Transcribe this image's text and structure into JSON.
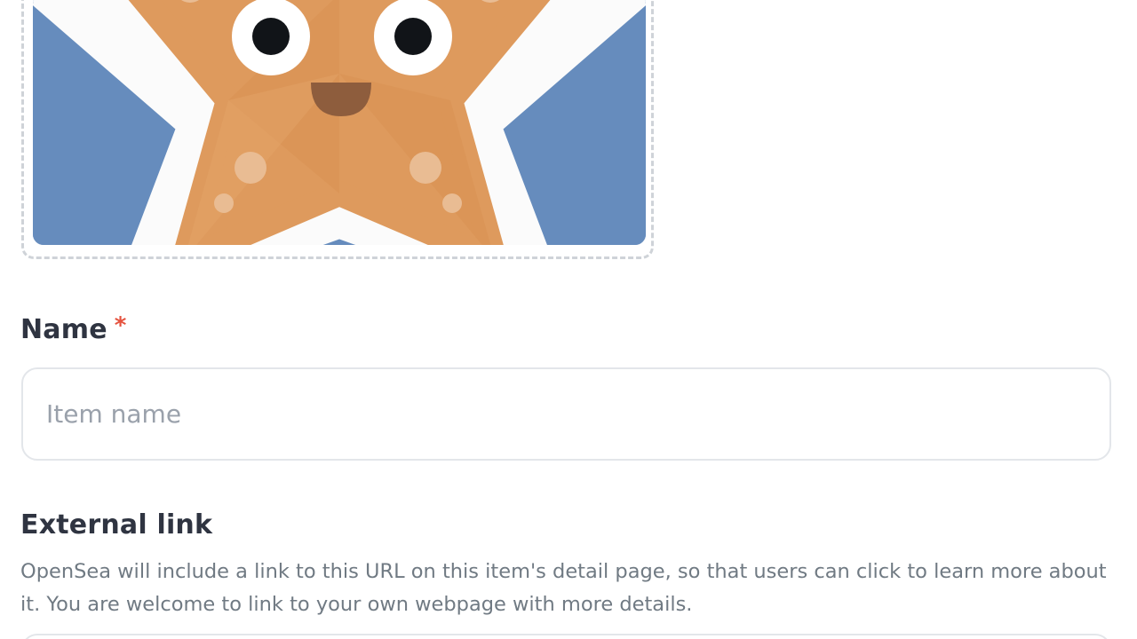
{
  "media": {
    "icon": "starfish-image"
  },
  "name_field": {
    "label": "Name",
    "required_marker": "*",
    "placeholder": "Item name",
    "value": ""
  },
  "external_link_field": {
    "label": "External link",
    "help_text": "OpenSea will include a link to this URL on this item's detail page, so that users can click to learn more about it. You are welcome to link to your own webpage with more details."
  },
  "colors": {
    "required": "#e5533f",
    "preview_background": "#668cbd",
    "starfish": "#de9a5d"
  }
}
